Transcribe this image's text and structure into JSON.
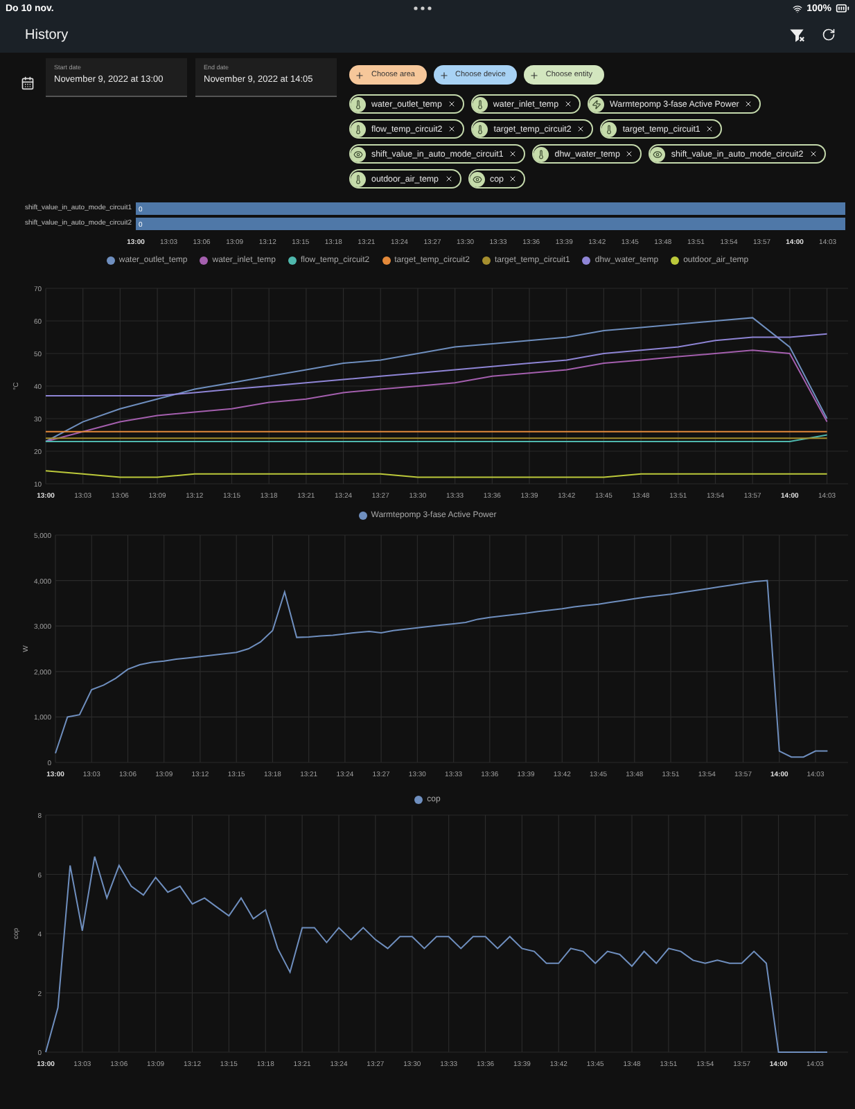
{
  "status_bar": {
    "time": "Do 10 nov.",
    "battery": "100%"
  },
  "header": {
    "title": "History"
  },
  "dates": [
    {
      "label": "Start date",
      "value": "November 9, 2022 at 13:00"
    },
    {
      "label": "End date",
      "value": "November 9, 2022 at 14:05"
    }
  ],
  "pickers": [
    {
      "label": "Choose area",
      "color": "#f6c79a"
    },
    {
      "label": "Choose device",
      "color": "#a8d2f4"
    },
    {
      "label": "Choose entity",
      "color": "#d3e6bf"
    }
  ],
  "entities": [
    {
      "label": "water_outlet_temp",
      "kind": "thermometer"
    },
    {
      "label": "water_inlet_temp",
      "kind": "thermometer"
    },
    {
      "label": "Warmtepomp 3-fase Active Power",
      "kind": "bolt"
    },
    {
      "label": "flow_temp_circuit2",
      "kind": "thermometer"
    },
    {
      "label": "target_temp_circuit2",
      "kind": "thermometer"
    },
    {
      "label": "target_temp_circuit1",
      "kind": "thermometer"
    },
    {
      "label": "shift_value_in_auto_mode_circuit1",
      "kind": "eye"
    },
    {
      "label": "dhw_water_temp",
      "kind": "thermometer"
    },
    {
      "label": "shift_value_in_auto_mode_circuit2",
      "kind": "eye"
    },
    {
      "label": "outdoor_air_temp",
      "kind": "thermometer"
    },
    {
      "label": "cop",
      "kind": "eye"
    }
  ],
  "timeline": {
    "rows": [
      {
        "label": "shift_value_in_auto_mode_circuit1",
        "value": "0"
      },
      {
        "label": "shift_value_in_auto_mode_circuit2",
        "value": "0"
      }
    ],
    "ticks": [
      "13:00",
      "13:03",
      "13:06",
      "13:09",
      "13:12",
      "13:15",
      "13:18",
      "13:21",
      "13:24",
      "13:27",
      "13:30",
      "13:33",
      "13:36",
      "13:39",
      "13:42",
      "13:45",
      "13:48",
      "13:51",
      "13:54",
      "13:57",
      "14:00",
      "14:03"
    ]
  },
  "charts": [
    {
      "chart_data": {
        "type": "line",
        "grid": true,
        "ylabel": "°C",
        "ylim": [
          10,
          70
        ],
        "yticks": [
          10,
          20,
          30,
          40,
          50,
          60,
          70
        ],
        "categories": [
          "13:00",
          "13:03",
          "13:06",
          "13:09",
          "13:12",
          "13:15",
          "13:18",
          "13:21",
          "13:24",
          "13:27",
          "13:30",
          "13:33",
          "13:36",
          "13:39",
          "13:42",
          "13:45",
          "13:48",
          "13:51",
          "13:54",
          "13:57",
          "14:00",
          "14:03"
        ],
        "series": [
          {
            "name": "water_outlet_temp",
            "color": "#6f8fbf",
            "values": [
              23,
              29,
              33,
              36,
              39,
              41,
              43,
              45,
              47,
              48,
              50,
              52,
              53,
              54,
              55,
              57,
              58,
              59,
              60,
              61,
              52,
              30
            ]
          },
          {
            "name": "water_inlet_temp",
            "color": "#a45fae",
            "values": [
              23,
              26,
              29,
              31,
              32,
              33,
              35,
              36,
              38,
              39,
              40,
              41,
              43,
              44,
              45,
              47,
              48,
              49,
              50,
              51,
              50,
              29
            ]
          },
          {
            "name": "flow_temp_circuit2",
            "color": "#4fb8ad",
            "values": [
              23,
              23,
              23,
              23,
              23,
              23,
              23,
              23,
              23,
              23,
              23,
              23,
              23,
              23,
              23,
              23,
              23,
              23,
              23,
              23,
              23,
              25
            ]
          },
          {
            "name": "target_temp_circuit2",
            "color": "#e3893a",
            "values": [
              26,
              26,
              26,
              26,
              26,
              26,
              26,
              26,
              26,
              26,
              26,
              26,
              26,
              26,
              26,
              26,
              26,
              26,
              26,
              26,
              26,
              26
            ]
          },
          {
            "name": "target_temp_circuit1",
            "color": "#a58e2e",
            "values": [
              24,
              24,
              24,
              24,
              24,
              24,
              24,
              24,
              24,
              24,
              24,
              24,
              24,
              24,
              24,
              24,
              24,
              24,
              24,
              24,
              24,
              24
            ]
          },
          {
            "name": "dhw_water_temp",
            "color": "#8f85d6",
            "values": [
              37,
              37,
              37,
              37,
              38,
              39,
              40,
              41,
              42,
              43,
              44,
              45,
              46,
              47,
              48,
              50,
              51,
              52,
              54,
              55,
              55,
              56
            ]
          },
          {
            "name": "outdoor_air_temp",
            "color": "#bcc93a",
            "values": [
              14,
              13,
              12,
              12,
              13,
              13,
              13,
              13,
              13,
              13,
              12,
              12,
              12,
              12,
              12,
              12,
              13,
              13,
              13,
              13,
              13,
              13
            ]
          }
        ]
      }
    },
    {
      "chart_data": {
        "type": "line",
        "grid": true,
        "ylabel": "W",
        "ylim": [
          0,
          5000
        ],
        "yticks": [
          {
            "value": 0,
            "label": "0"
          },
          {
            "value": 1000,
            "label": "1,000"
          },
          {
            "value": 2000,
            "label": "2,000"
          },
          {
            "value": 3000,
            "label": "3,000"
          },
          {
            "value": 4000,
            "label": "4,000"
          },
          {
            "value": 5000,
            "label": "5,000"
          }
        ],
        "categories": [
          "13:00",
          null,
          null,
          "13:03",
          null,
          null,
          "13:06",
          null,
          null,
          "13:09",
          null,
          null,
          "13:12",
          null,
          null,
          "13:15",
          null,
          null,
          "13:18",
          null,
          null,
          "13:21",
          null,
          null,
          "13:24",
          null,
          null,
          "13:27",
          null,
          null,
          "13:30",
          null,
          null,
          "13:33",
          null,
          null,
          "13:36",
          null,
          null,
          "13:39",
          null,
          null,
          "13:42",
          null,
          null,
          "13:45",
          null,
          null,
          "13:48",
          null,
          null,
          "13:51",
          null,
          null,
          "13:54",
          null,
          null,
          "13:57",
          null,
          null,
          "14:00",
          null,
          null,
          "14:03",
          null
        ],
        "series": [
          {
            "name": "Warmtepomp 3-fase Active Power",
            "color": "#6f8fbf",
            "values": [
              200,
              1000,
              1050,
              1600,
              1700,
              1850,
              2050,
              2150,
              2200,
              2230,
              2270,
              2300,
              2330,
              2360,
              2390,
              2420,
              2500,
              2650,
              2900,
              3750,
              2750,
              2760,
              2780,
              2800,
              2830,
              2860,
              2880,
              2850,
              2900,
              2930,
              2960,
              2990,
              3020,
              3050,
              3080,
              3150,
              3190,
              3220,
              3250,
              3280,
              3320,
              3350,
              3380,
              3420,
              3450,
              3480,
              3520,
              3560,
              3600,
              3640,
              3670,
              3700,
              3740,
              3780,
              3820,
              3860,
              3900,
              3940,
              3980,
              4000,
              250,
              120,
              120,
              250,
              250
            ]
          }
        ]
      }
    },
    {
      "chart_data": {
        "type": "line",
        "grid": true,
        "ylabel": "cop",
        "ylim": [
          0,
          8
        ],
        "yticks": [
          0,
          2,
          4,
          6,
          8
        ],
        "categories": [
          "13:00",
          null,
          null,
          "13:03",
          null,
          null,
          "13:06",
          null,
          null,
          "13:09",
          null,
          null,
          "13:12",
          null,
          null,
          "13:15",
          null,
          null,
          "13:18",
          null,
          null,
          "13:21",
          null,
          null,
          "13:24",
          null,
          null,
          "13:27",
          null,
          null,
          "13:30",
          null,
          null,
          "13:33",
          null,
          null,
          "13:36",
          null,
          null,
          "13:39",
          null,
          null,
          "13:42",
          null,
          null,
          "13:45",
          null,
          null,
          "13:48",
          null,
          null,
          "13:51",
          null,
          null,
          "13:54",
          null,
          null,
          "13:57",
          null,
          null,
          "14:00",
          null,
          null,
          "14:03",
          null
        ],
        "series": [
          {
            "name": "cop",
            "color": "#6f8fbf",
            "values": [
              0,
              1.5,
              6.3,
              4.1,
              6.6,
              5.2,
              6.3,
              5.6,
              5.3,
              5.9,
              5.4,
              5.6,
              5.0,
              5.2,
              4.9,
              4.6,
              5.2,
              4.5,
              4.8,
              3.5,
              2.7,
              4.2,
              4.2,
              3.7,
              4.2,
              3.8,
              4.2,
              3.8,
              3.5,
              3.9,
              3.9,
              3.5,
              3.9,
              3.9,
              3.5,
              3.9,
              3.9,
              3.5,
              3.9,
              3.5,
              3.4,
              3.0,
              3.0,
              3.5,
              3.4,
              3.0,
              3.4,
              3.3,
              2.9,
              3.4,
              3.0,
              3.5,
              3.4,
              3.1,
              3.0,
              3.1,
              3.0,
              3.0,
              3.4,
              3.0,
              0,
              0,
              0,
              0,
              0
            ]
          }
        ]
      }
    }
  ]
}
